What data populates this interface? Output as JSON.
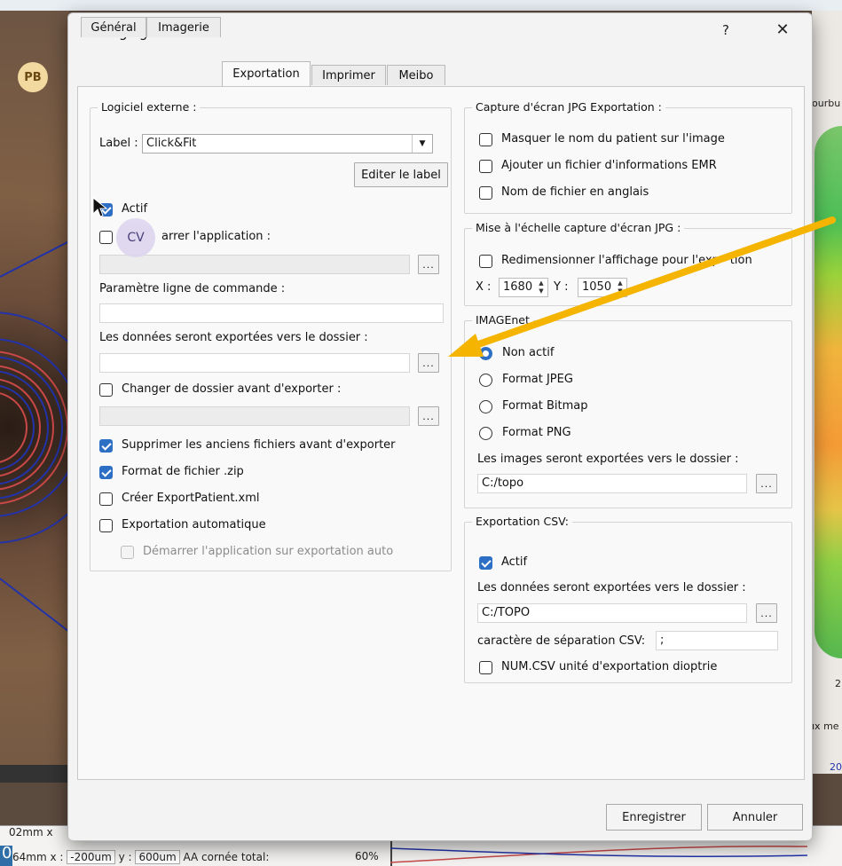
{
  "background": {
    "right_label_top": "ourbu",
    "right_label_mid": "ıx me",
    "right_num_2": "2",
    "right_num_20": "20",
    "bottom_row1": "02mm  x",
    "bottom_row2_a": "64mm",
    "bottom_row2_x": "x :",
    "bottom_row2_xval": "-200um",
    "bottom_row2_y": "y :",
    "bottom_row2_yval": "600um",
    "bottom_row2_label": "AA cornée total:",
    "bottom_row2_pct": "60%",
    "bottom_blue_digit": "0"
  },
  "avatars": {
    "pb": "PB",
    "cv": "CV"
  },
  "dialog": {
    "title": "Réglages",
    "help": "?",
    "close": "✕",
    "tabs": [
      {
        "label": "Général"
      },
      {
        "label": "Imagerie"
      },
      {
        "label": "Exportation",
        "active": true
      },
      {
        "label": "Imprimer"
      },
      {
        "label": "Meibo"
      }
    ],
    "left": {
      "logiciel_title": "Logiciel externe :",
      "label_prefix": "Label :",
      "label_value": "Click&Fit",
      "edit_label_button": "Editer le label",
      "actif_label": "Actif",
      "actif_checked": true,
      "demarrer_label": "arrer l'application :",
      "demarrer_checked": false,
      "app_path_value": "",
      "browse_label": "...",
      "cmdline_label": "Paramètre ligne de commande :",
      "cmdline_value": "",
      "export_folder_label": "Les données seront exportées vers le dossier :",
      "export_folder_value": "",
      "change_folder_label": "Changer de dossier avant d'exporter :",
      "change_folder_checked": false,
      "change_folder_value": "",
      "options": [
        {
          "label": "Supprimer les anciens fichiers avant d'exporter",
          "checked": true
        },
        {
          "label": "Format de fichier .zip",
          "checked": true
        },
        {
          "label": "Créer ExportPatient.xml",
          "checked": false
        },
        {
          "label": "Exportation automatique",
          "checked": false
        }
      ],
      "auto_start_label": "Démarrer l'application sur exportation auto",
      "auto_start_checked": false
    },
    "right": {
      "capture_title": "Capture d'écran JPG Exportation :",
      "capture_options": [
        {
          "label": "Masquer le nom du patient sur l'image",
          "checked": false
        },
        {
          "label": "Ajouter un fichier d'informations EMR",
          "checked": false
        },
        {
          "label": "Nom de fichier en anglais",
          "checked": false
        }
      ],
      "scale_title": "Mise à l'échelle capture d'écran JPG :",
      "resize_label": "Redimensionner l'affichage pour l'exp",
      "resize_label_tail": "tion",
      "resize_checked": false,
      "x_label": "X :",
      "x_value": "1680",
      "y_label": "Y :",
      "y_value": "1050",
      "imagenet_title": "IMAGEnet",
      "imagenet_options": [
        {
          "label": "Non actif",
          "checked": true
        },
        {
          "label": "Format JPEG",
          "checked": false
        },
        {
          "label": "Format Bitmap",
          "checked": false
        },
        {
          "label": "Format PNG",
          "checked": false
        }
      ],
      "images_folder_label": "Les images seront exportées vers le dossier :",
      "images_folder_value": "C:/topo",
      "csv_title": "Exportation CSV:",
      "csv_actif_label": "Actif",
      "csv_actif_checked": true,
      "csv_folder_label": "Les données seront exportées vers le dossier :",
      "csv_folder_value": "C:/TOPO",
      "csv_sep_label": "caractère de séparation CSV:",
      "csv_sep_value": ";",
      "csv_dioptrie_label": "NUM.CSV unité d'exportation dioptrie",
      "csv_dioptrie_checked": false
    },
    "footer": {
      "save": "Enregistrer",
      "cancel": "Annuler"
    }
  },
  "colors": {
    "accent": "#2d6fc4",
    "arrow": "#f5b400",
    "dialog_bg": "#f3f3f3"
  }
}
